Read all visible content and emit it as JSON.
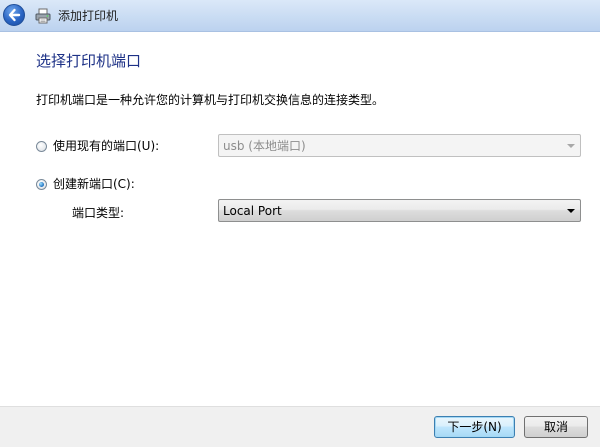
{
  "window": {
    "title": "添加打印机",
    "back_icon": "back-arrow-icon",
    "printer_icon": "printer-icon"
  },
  "page": {
    "heading": "选择打印机端口",
    "description": "打印机端口是一种允许您的计算机与打印机交换信息的连接类型。"
  },
  "existing_port": {
    "label": "使用现有的端口(U):",
    "checked": false,
    "value": "usb (本地端口)",
    "enabled": false
  },
  "new_port": {
    "label": "创建新端口(C):",
    "checked": true,
    "type_label": "端口类型:",
    "type_value": "Local Port",
    "enabled": true
  },
  "footer": {
    "next_label": "下一步(N)",
    "cancel_label": "取消"
  },
  "colors": {
    "heading": "#1e3287",
    "title_bar": "#c9dcf3",
    "footer_bg": "#f0f0f0"
  }
}
